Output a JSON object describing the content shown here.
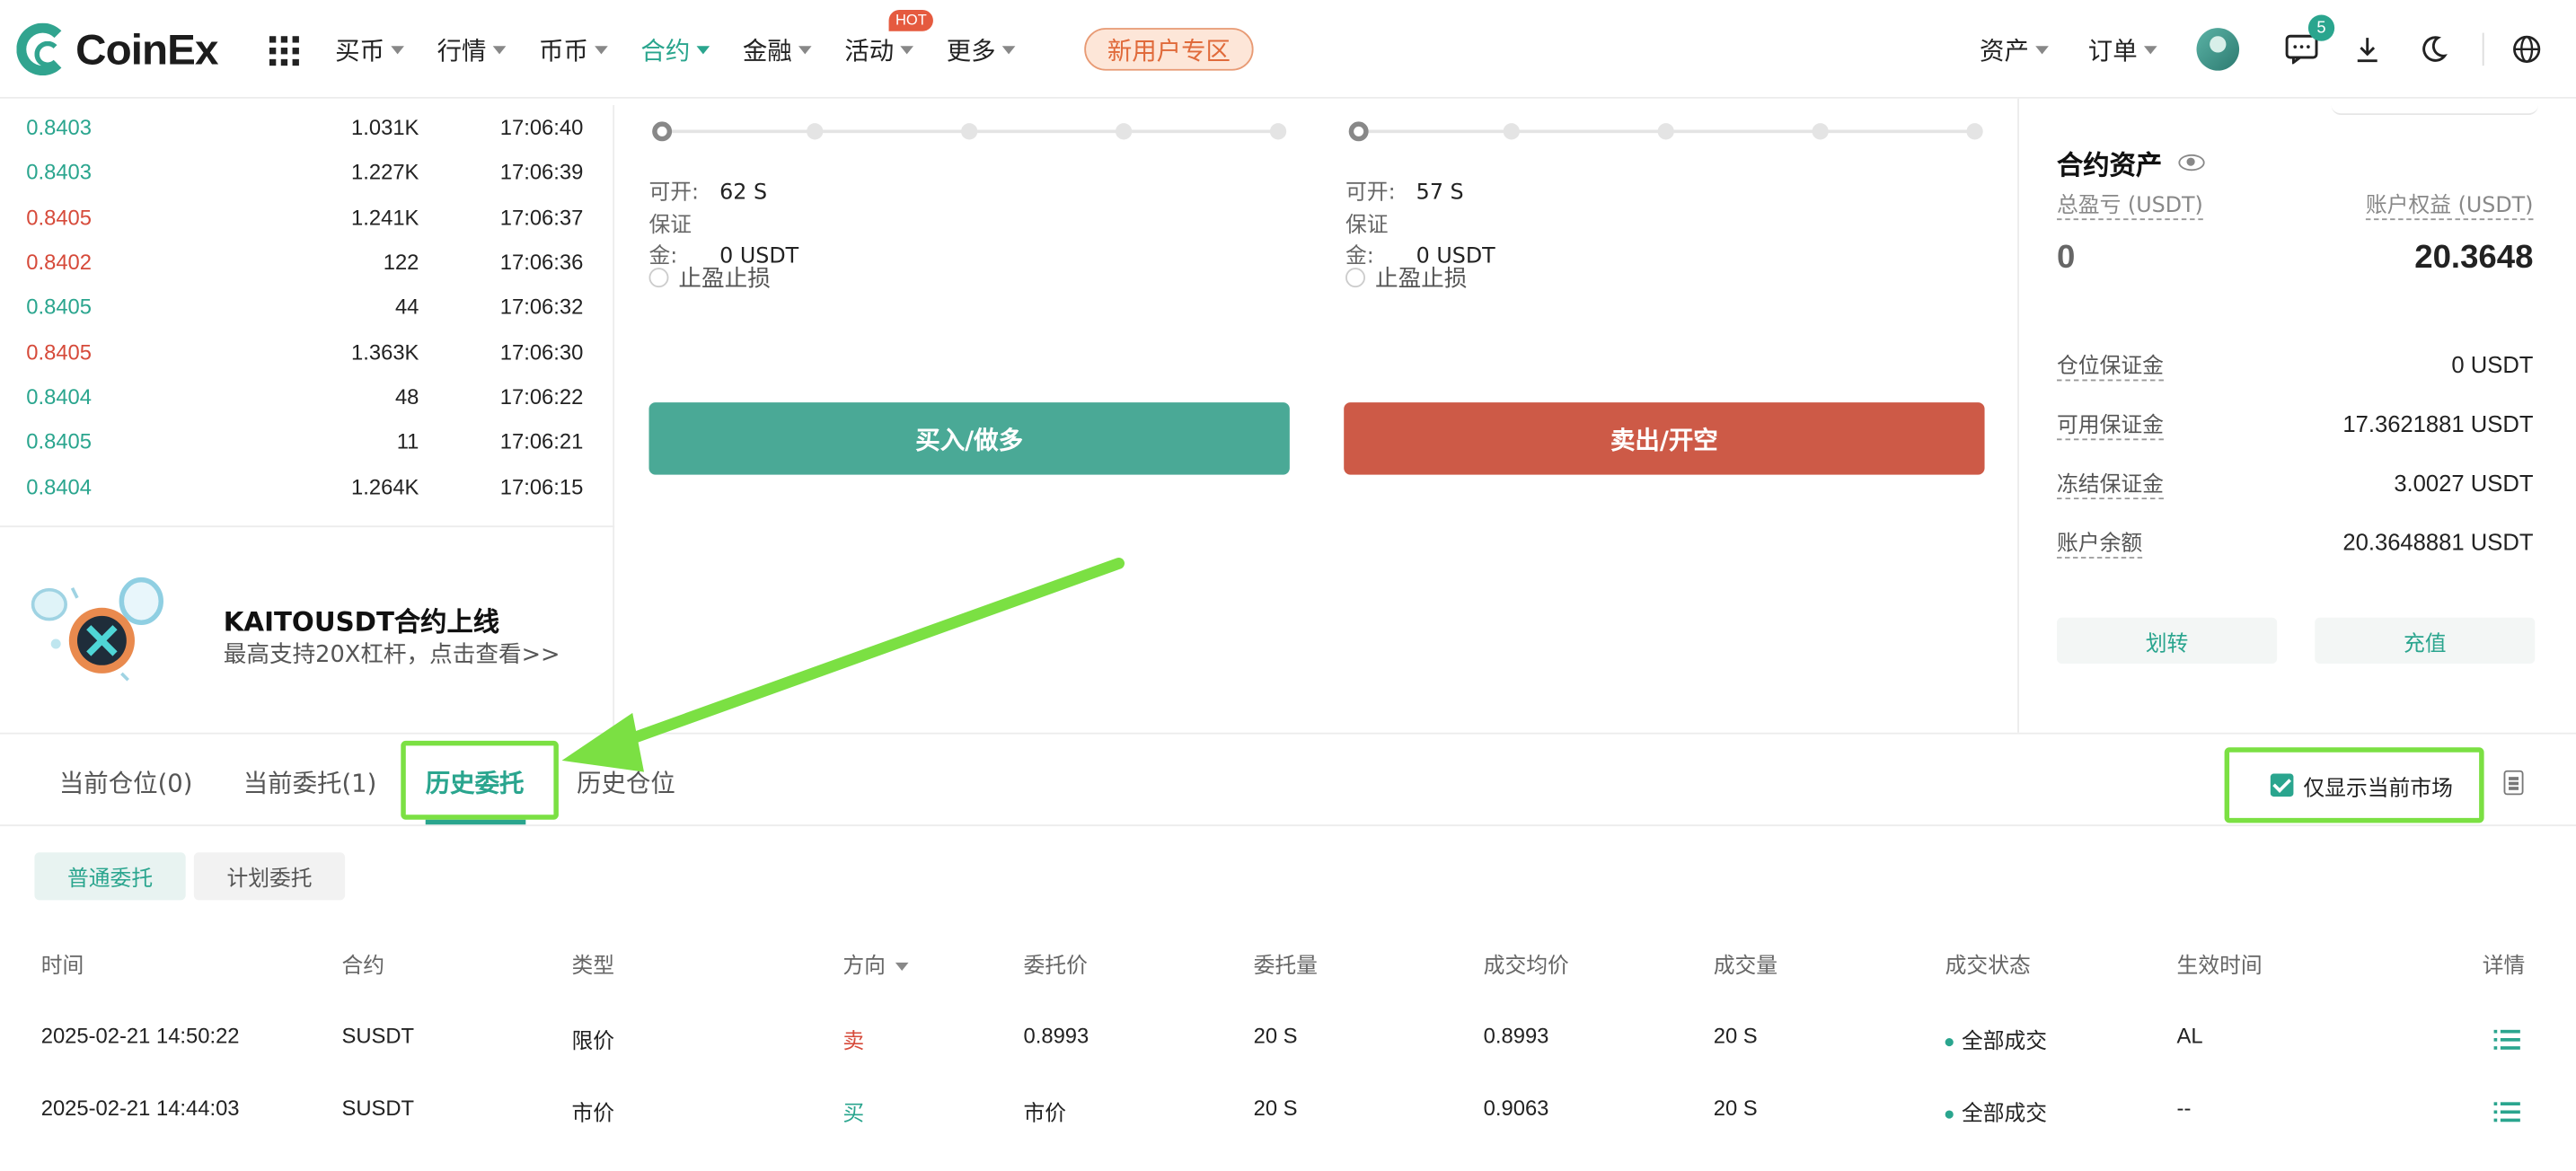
{
  "nav": {
    "logo": "CoinEx",
    "menu": [
      {
        "label": "买币",
        "active": false
      },
      {
        "label": "行情",
        "active": false
      },
      {
        "label": "币币",
        "active": false
      },
      {
        "label": "合约",
        "active": true
      },
      {
        "label": "金融",
        "active": false
      },
      {
        "label": "活动",
        "active": false,
        "badge": "HOT"
      },
      {
        "label": "更多",
        "active": false
      }
    ],
    "new_user": "新用户专区",
    "right": {
      "assets": "资产",
      "orders": "订单",
      "messages_count": "5"
    }
  },
  "trades": [
    {
      "price": "0.8403",
      "qty": "1.031K",
      "time": "17:06:40",
      "side": "buy"
    },
    {
      "price": "0.8403",
      "qty": "1.227K",
      "time": "17:06:39",
      "side": "buy"
    },
    {
      "price": "0.8405",
      "qty": "1.241K",
      "time": "17:06:37",
      "side": "sell"
    },
    {
      "price": "0.8402",
      "qty": "122",
      "time": "17:06:36",
      "side": "sell"
    },
    {
      "price": "0.8405",
      "qty": "44",
      "time": "17:06:32",
      "side": "buy"
    },
    {
      "price": "0.8405",
      "qty": "1.363K",
      "time": "17:06:30",
      "side": "sell"
    },
    {
      "price": "0.8404",
      "qty": "48",
      "time": "17:06:22",
      "side": "buy"
    },
    {
      "price": "0.8405",
      "qty": "11",
      "time": "17:06:21",
      "side": "buy"
    },
    {
      "price": "0.8404",
      "qty": "1.264K",
      "time": "17:06:15",
      "side": "buy"
    }
  ],
  "promo": {
    "title": "KAITOUSDT合约上线",
    "subtitle": "最高支持20X杠杆，点击查看>>"
  },
  "order": {
    "buy": {
      "open_label": "可开:",
      "open_value": "62 S",
      "margin_label": "保证金:",
      "margin_value": "0 USDT",
      "tpsl": "止盈止损",
      "button": "买入/做多"
    },
    "sell": {
      "open_label": "可开:",
      "open_value": "57 S",
      "margin_label": "保证金:",
      "margin_value": "0 USDT",
      "tpsl": "止盈止损",
      "button": "卖出/开空"
    }
  },
  "assets": {
    "title": "合约资产",
    "pnl_label": "总盈亏 (USDT)",
    "equity_label": "账户权益 (USDT)",
    "pnl_value": "0",
    "equity_value": "20.3648",
    "rows": [
      {
        "label": "仓位保证金",
        "value": "0 USDT"
      },
      {
        "label": "可用保证金",
        "value": "17.3621881 USDT"
      },
      {
        "label": "冻结保证金",
        "value": "3.0027 USDT"
      },
      {
        "label": "账户余额",
        "value": "20.3648881 USDT"
      }
    ],
    "transfer": "划转",
    "deposit": "充值"
  },
  "bottom": {
    "tabs": [
      {
        "label": "当前仓位(0)"
      },
      {
        "label": "当前委托(1)"
      },
      {
        "label": "历史委托"
      },
      {
        "label": "历史仓位"
      }
    ],
    "only_current": "仅显示当前市场",
    "subtabs": [
      {
        "label": "普通委托"
      },
      {
        "label": "计划委托"
      }
    ],
    "columns": [
      "时间",
      "合约",
      "类型",
      "方向",
      "委托价",
      "委托量",
      "成交均价",
      "成交量",
      "成交状态",
      "生效时间",
      "详情"
    ],
    "rows": [
      {
        "time": "2025-02-21 14:50:22",
        "contract": "SUSDT",
        "type": "限价",
        "side": "卖",
        "price": "0.8993",
        "qty": "20 S",
        "avg": "0.8993",
        "filled": "20 S",
        "status": "全部成交",
        "effective": "AL"
      },
      {
        "time": "2025-02-21 14:44:03",
        "contract": "SUSDT",
        "type": "市价",
        "side": "买",
        "price": "市价",
        "qty": "20 S",
        "avg": "0.9063",
        "filled": "20 S",
        "status": "全部成交",
        "effective": "--"
      }
    ]
  },
  "colors": {
    "accent": "#2aa58e",
    "buy": "#2aa58e",
    "sell": "#d64a3a",
    "annotation": "#7be043"
  }
}
